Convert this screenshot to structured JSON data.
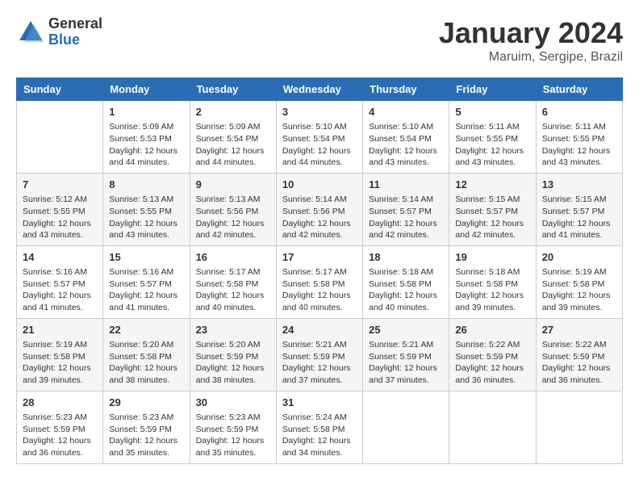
{
  "header": {
    "logo_general": "General",
    "logo_blue": "Blue",
    "month_title": "January 2024",
    "location": "Maruim, Sergipe, Brazil"
  },
  "days_of_week": [
    "Sunday",
    "Monday",
    "Tuesday",
    "Wednesday",
    "Thursday",
    "Friday",
    "Saturday"
  ],
  "weeks": [
    [
      {
        "day": "",
        "info": ""
      },
      {
        "day": "1",
        "info": "Sunrise: 5:09 AM\nSunset: 5:53 PM\nDaylight: 12 hours\nand 44 minutes."
      },
      {
        "day": "2",
        "info": "Sunrise: 5:09 AM\nSunset: 5:54 PM\nDaylight: 12 hours\nand 44 minutes."
      },
      {
        "day": "3",
        "info": "Sunrise: 5:10 AM\nSunset: 5:54 PM\nDaylight: 12 hours\nand 44 minutes."
      },
      {
        "day": "4",
        "info": "Sunrise: 5:10 AM\nSunset: 5:54 PM\nDaylight: 12 hours\nand 43 minutes."
      },
      {
        "day": "5",
        "info": "Sunrise: 5:11 AM\nSunset: 5:55 PM\nDaylight: 12 hours\nand 43 minutes."
      },
      {
        "day": "6",
        "info": "Sunrise: 5:11 AM\nSunset: 5:55 PM\nDaylight: 12 hours\nand 43 minutes."
      }
    ],
    [
      {
        "day": "7",
        "info": ""
      },
      {
        "day": "8",
        "info": "Sunrise: 5:13 AM\nSunset: 5:55 PM\nDaylight: 12 hours\nand 43 minutes."
      },
      {
        "day": "9",
        "info": "Sunrise: 5:13 AM\nSunset: 5:56 PM\nDaylight: 12 hours\nand 42 minutes."
      },
      {
        "day": "10",
        "info": "Sunrise: 5:14 AM\nSunset: 5:56 PM\nDaylight: 12 hours\nand 42 minutes."
      },
      {
        "day": "11",
        "info": "Sunrise: 5:14 AM\nSunset: 5:57 PM\nDaylight: 12 hours\nand 42 minutes."
      },
      {
        "day": "12",
        "info": "Sunrise: 5:15 AM\nSunset: 5:57 PM\nDaylight: 12 hours\nand 42 minutes."
      },
      {
        "day": "13",
        "info": "Sunrise: 5:15 AM\nSunset: 5:57 PM\nDaylight: 12 hours\nand 41 minutes."
      }
    ],
    [
      {
        "day": "14",
        "info": ""
      },
      {
        "day": "15",
        "info": "Sunrise: 5:16 AM\nSunset: 5:57 PM\nDaylight: 12 hours\nand 41 minutes."
      },
      {
        "day": "16",
        "info": "Sunrise: 5:17 AM\nSunset: 5:58 PM\nDaylight: 12 hours\nand 40 minutes."
      },
      {
        "day": "17",
        "info": "Sunrise: 5:17 AM\nSunset: 5:58 PM\nDaylight: 12 hours\nand 40 minutes."
      },
      {
        "day": "18",
        "info": "Sunrise: 5:18 AM\nSunset: 5:58 PM\nDaylight: 12 hours\nand 40 minutes."
      },
      {
        "day": "19",
        "info": "Sunrise: 5:18 AM\nSunset: 5:58 PM\nDaylight: 12 hours\nand 39 minutes."
      },
      {
        "day": "20",
        "info": "Sunrise: 5:19 AM\nSunset: 5:58 PM\nDaylight: 12 hours\nand 39 minutes."
      }
    ],
    [
      {
        "day": "21",
        "info": ""
      },
      {
        "day": "22",
        "info": "Sunrise: 5:20 AM\nSunset: 5:58 PM\nDaylight: 12 hours\nand 38 minutes."
      },
      {
        "day": "23",
        "info": "Sunrise: 5:20 AM\nSunset: 5:59 PM\nDaylight: 12 hours\nand 38 minutes."
      },
      {
        "day": "24",
        "info": "Sunrise: 5:21 AM\nSunset: 5:59 PM\nDaylight: 12 hours\nand 37 minutes."
      },
      {
        "day": "25",
        "info": "Sunrise: 5:21 AM\nSunset: 5:59 PM\nDaylight: 12 hours\nand 37 minutes."
      },
      {
        "day": "26",
        "info": "Sunrise: 5:22 AM\nSunset: 5:59 PM\nDaylight: 12 hours\nand 36 minutes."
      },
      {
        "day": "27",
        "info": "Sunrise: 5:22 AM\nSunset: 5:59 PM\nDaylight: 12 hours\nand 36 minutes."
      }
    ],
    [
      {
        "day": "28",
        "info": "Sunrise: 5:23 AM\nSunset: 5:59 PM\nDaylight: 12 hours\nand 36 minutes."
      },
      {
        "day": "29",
        "info": "Sunrise: 5:23 AM\nSunset: 5:59 PM\nDaylight: 12 hours\nand 35 minutes."
      },
      {
        "day": "30",
        "info": "Sunrise: 5:23 AM\nSunset: 5:59 PM\nDaylight: 12 hours\nand 35 minutes."
      },
      {
        "day": "31",
        "info": "Sunrise: 5:24 AM\nSunset: 5:58 PM\nDaylight: 12 hours\nand 34 minutes."
      },
      {
        "day": "",
        "info": ""
      },
      {
        "day": "",
        "info": ""
      },
      {
        "day": "",
        "info": ""
      }
    ]
  ],
  "week1_sun_info": "Sunrise: 5:12 AM\nSunset: 5:55 PM\nDaylight: 12 hours\nand 43 minutes.",
  "week3_sun_info": "Sunrise: 5:16 AM\nSunset: 5:57 PM\nDaylight: 12 hours\nand 41 minutes.",
  "week4_sun_info": "Sunrise: 5:19 AM\nSunset: 5:58 PM\nDaylight: 12 hours\nand 39 minutes."
}
